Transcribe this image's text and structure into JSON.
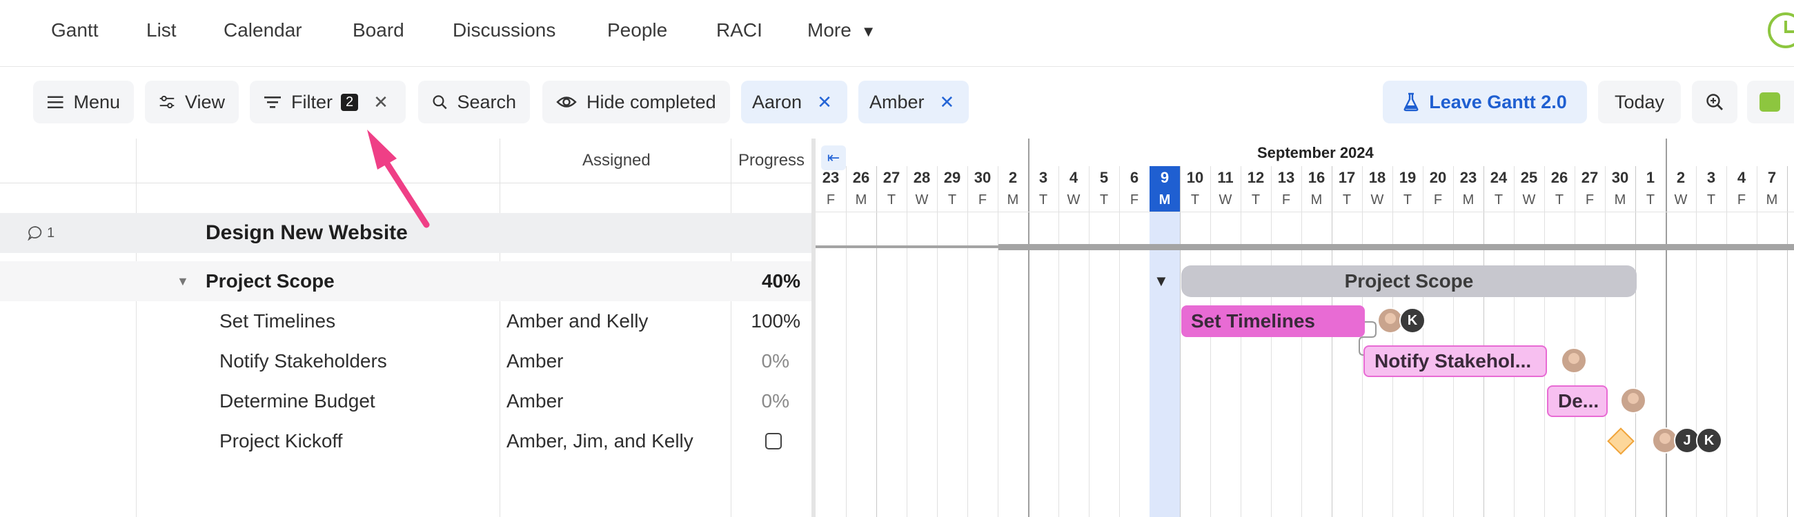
{
  "nav": {
    "items": [
      "Gantt",
      "List",
      "Calendar",
      "Board",
      "Discussions",
      "People",
      "RACI"
    ],
    "more_label": "More"
  },
  "toolbar": {
    "menu_label": "Menu",
    "view_label": "View",
    "filter_label": "Filter",
    "filter_count": "2",
    "search_label": "Search",
    "hide_completed_label": "Hide completed",
    "chips": [
      "Aaron",
      "Amber"
    ],
    "leave_label": "Leave Gantt 2.0",
    "today_label": "Today"
  },
  "grid": {
    "columns": {
      "assigned": "Assigned",
      "progress": "Progress"
    },
    "project": {
      "comments": "1",
      "name": "Design New Website"
    },
    "group": {
      "name": "Project Scope",
      "progress": "40%"
    },
    "tasks": [
      {
        "name": "Set Timelines",
        "assigned": "Amber and Kelly",
        "progress": "100%"
      },
      {
        "name": "Notify Stakeholders",
        "assigned": "Amber",
        "progress": "0%"
      },
      {
        "name": "Determine Budget",
        "assigned": "Amber",
        "progress": "0%"
      },
      {
        "name": "Project Kickoff",
        "assigned": "Amber, Jim, and Kelly",
        "progress": ""
      }
    ]
  },
  "gantt": {
    "month_label": "September 2024",
    "days": [
      {
        "n": "23",
        "d": "F"
      },
      {
        "n": "26",
        "d": "M"
      },
      {
        "n": "27",
        "d": "T"
      },
      {
        "n": "28",
        "d": "W"
      },
      {
        "n": "29",
        "d": "T"
      },
      {
        "n": "30",
        "d": "F"
      },
      {
        "n": "2",
        "d": "M"
      },
      {
        "n": "3",
        "d": "T"
      },
      {
        "n": "4",
        "d": "W"
      },
      {
        "n": "5",
        "d": "T"
      },
      {
        "n": "6",
        "d": "F"
      },
      {
        "n": "9",
        "d": "M"
      },
      {
        "n": "10",
        "d": "T"
      },
      {
        "n": "11",
        "d": "W"
      },
      {
        "n": "12",
        "d": "T"
      },
      {
        "n": "13",
        "d": "F"
      },
      {
        "n": "16",
        "d": "M"
      },
      {
        "n": "17",
        "d": "T"
      },
      {
        "n": "18",
        "d": "W"
      },
      {
        "n": "19",
        "d": "T"
      },
      {
        "n": "20",
        "d": "F"
      },
      {
        "n": "23",
        "d": "M"
      },
      {
        "n": "24",
        "d": "T"
      },
      {
        "n": "25",
        "d": "W"
      },
      {
        "n": "26",
        "d": "T"
      },
      {
        "n": "27",
        "d": "F"
      },
      {
        "n": "30",
        "d": "M"
      },
      {
        "n": "1",
        "d": "T"
      },
      {
        "n": "2",
        "d": "W"
      },
      {
        "n": "3",
        "d": "T"
      },
      {
        "n": "4",
        "d": "F"
      },
      {
        "n": "7",
        "d": "M"
      }
    ],
    "bars": {
      "group": "Project Scope",
      "set_timelines": "Set Timelines",
      "notify": "Notify Stakehol...",
      "budget": "De..."
    },
    "avatar_initials": {
      "k": "K",
      "j": "J"
    }
  },
  "colors": {
    "accent": "#1f5fd1",
    "task_bar": "#e86bd4",
    "task_bar_light": "#f7bff0",
    "group_bar": "#c7c7ce",
    "milestone": "#fdd79a",
    "arrow": "#ef3f86",
    "today_column": "#dde7fb",
    "brand_green": "#8dc63f"
  }
}
